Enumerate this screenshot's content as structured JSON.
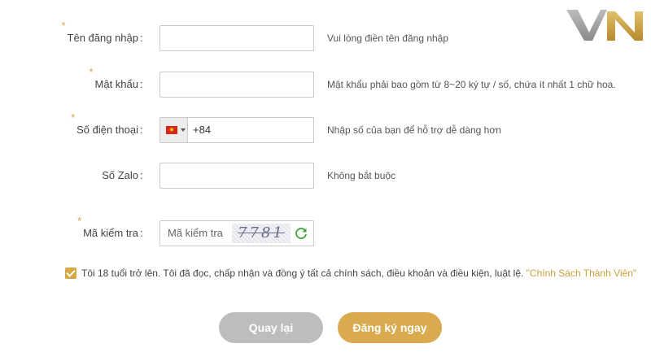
{
  "brand": {
    "logo_text": "VN"
  },
  "form": {
    "username": {
      "label": "Tên đăng nhập",
      "required": true,
      "colon": ":",
      "value": "",
      "hint": "Vui lòng điền tên đăng nhập"
    },
    "password": {
      "label": "Mật khẩu",
      "required": true,
      "colon": ":",
      "value": "",
      "hint": "Mật khẩu phải bao gồm từ 8~20 ký tự / số, chứa ít nhất 1 chữ hoa."
    },
    "phone": {
      "label": "Số điện thoại",
      "required": true,
      "colon": ":",
      "country_flag": "vietnam-flag",
      "value": "+84",
      "hint": "Nhập số của bạn để hỗ trợ dễ dàng hơn"
    },
    "zalo": {
      "label": "Số Zalo",
      "required": false,
      "colon": ":",
      "value": "",
      "hint": "Không bắt buộc"
    },
    "captcha": {
      "label": "Mã kiểm tra",
      "required": true,
      "colon": ":",
      "placeholder": "Mã kiểm tra",
      "code": "7781",
      "refresh_icon": "refresh-icon"
    }
  },
  "agreement": {
    "checked": true,
    "text": "Tôi 18 tuổi trở lên. Tôi đã đọc, chấp nhận và đồng ý tất cả chính sách, điều khoản và điều kiện, luật lệ.",
    "link_text": "\"Chính Sách Thành Viên\""
  },
  "buttons": {
    "back_label": "Quay lại",
    "submit_label": "Đăng ký ngay"
  },
  "colors": {
    "accent": "#d4a843",
    "submit": "#d9aa4e",
    "back": "#bdbdbd",
    "link": "#c9a13b"
  }
}
